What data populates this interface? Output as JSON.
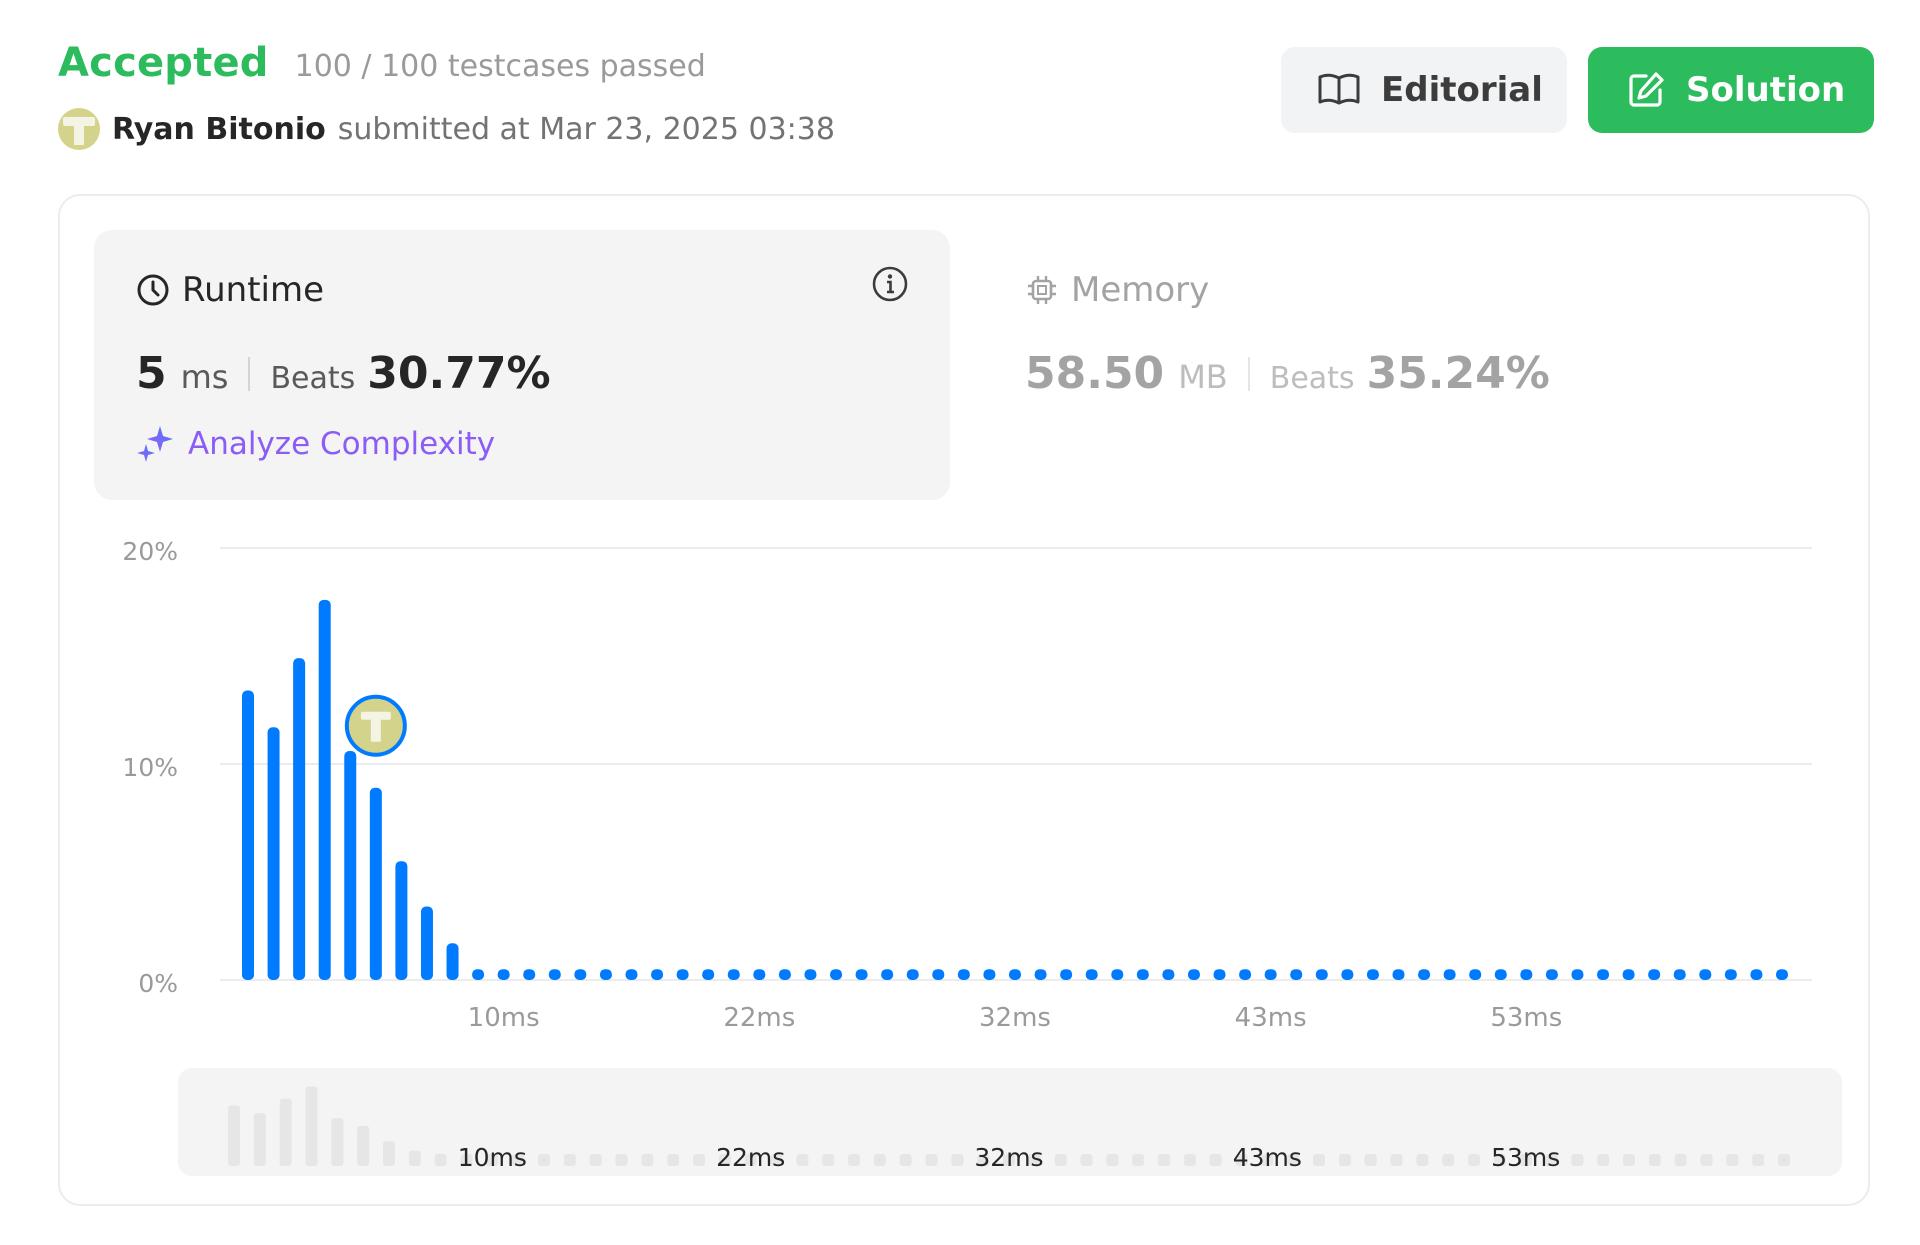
{
  "header": {
    "status": "Accepted",
    "testcases": "100 / 100 testcases passed",
    "user_name": "Ryan Bitonio",
    "submitted": "submitted at Mar 23, 2025 03:38"
  },
  "buttons": {
    "editorial": "Editorial",
    "solution": "Solution"
  },
  "runtime": {
    "title": "Runtime",
    "value": "5",
    "unit": "ms",
    "beats_label": "Beats",
    "beats_value": "30.77%",
    "analyze": "Analyze Complexity"
  },
  "memory": {
    "title": "Memory",
    "value": "58.50",
    "unit": "MB",
    "beats_label": "Beats",
    "beats_value": "35.24%"
  },
  "colors": {
    "accepted": "#2cbb5d",
    "bar": "#007aff",
    "analyze": "#8b5cf6",
    "mini_bar": "#e6e6e6"
  },
  "chart_data": {
    "type": "bar",
    "x_unit": "ms",
    "y_ticks": [
      "20%",
      "10%",
      "0%"
    ],
    "ylim": [
      0,
      20
    ],
    "x_tick_labels": [
      "10ms",
      "22ms",
      "32ms",
      "43ms",
      "53ms"
    ],
    "x_tick_bar_index": [
      10,
      20,
      30,
      40,
      50
    ],
    "values": [
      13.4,
      11.7,
      14.9,
      17.6,
      10.6,
      8.9,
      5.5,
      3.4,
      1.7,
      0.5,
      0.5,
      0.5,
      0.5,
      0.5,
      0.5,
      0.5,
      0.5,
      0.5,
      0.5,
      0.5,
      0.5,
      0.5,
      0.5,
      0.5,
      0.5,
      0.5,
      0.5,
      0.5,
      0.5,
      0.5,
      0.5,
      0.5,
      0.5,
      0.5,
      0.5,
      0.5,
      0.5,
      0.5,
      0.5,
      0.5,
      0.5,
      0.5,
      0.5,
      0.5,
      0.5,
      0.5,
      0.5,
      0.5,
      0.5,
      0.5,
      0.5,
      0.5,
      0.5,
      0.5,
      0.5,
      0.5,
      0.5,
      0.5,
      0.5,
      0.5,
      0.5
    ],
    "highlight_bar_index": 5,
    "grid": true
  }
}
